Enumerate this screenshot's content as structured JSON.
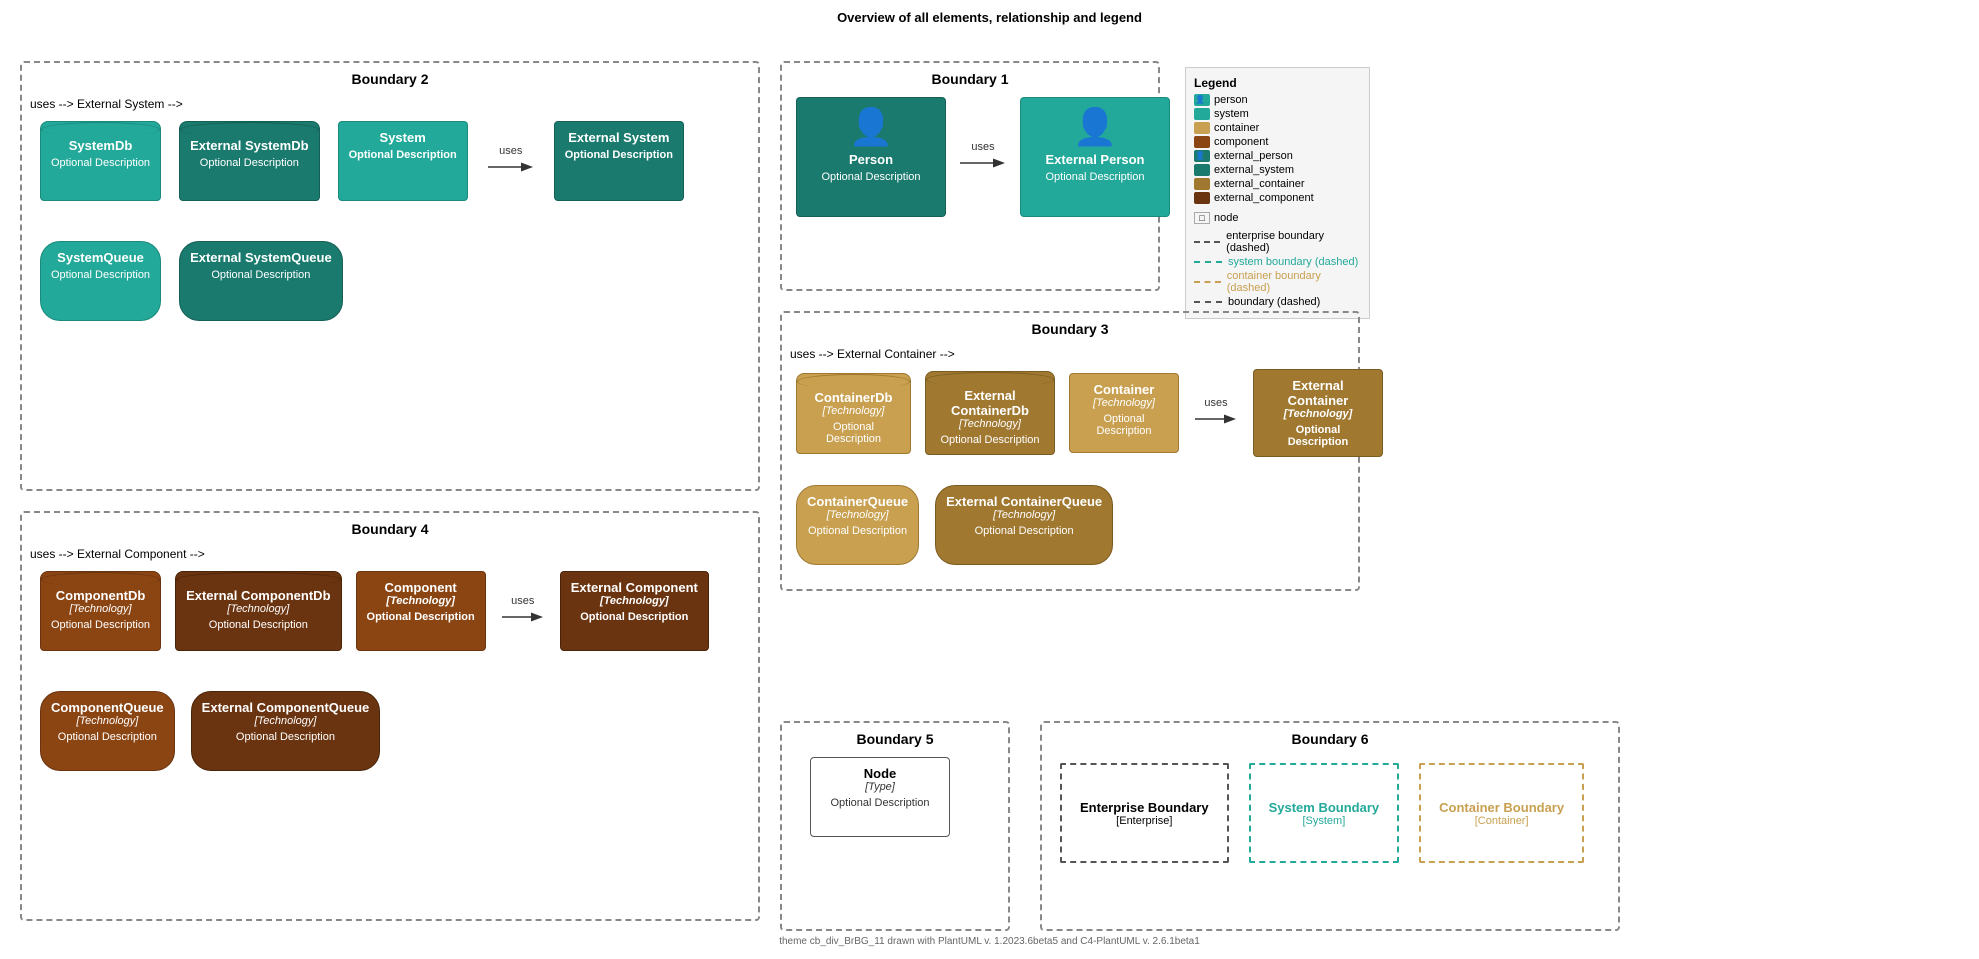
{
  "title": "Overview of all elements, relationship and legend",
  "footer": "theme cb_div_BrBG_11 drawn with PlantUML v. 1.2023.6beta5 and C4-PlantUML v. 2.6.1beta1",
  "uses_label": "uses",
  "optional_desc": "Optional Description",
  "boundaries": {
    "b1": {
      "label": "Boundary 1"
    },
    "b2": {
      "label": "Boundary 2"
    },
    "b3": {
      "label": "Boundary 3"
    },
    "b4": {
      "label": "Boundary 4"
    },
    "b5": {
      "label": "Boundary 5"
    },
    "b6": {
      "label": "Boundary 6"
    }
  },
  "elements": {
    "system_db": {
      "title": "SystemDb",
      "desc": "Optional Description"
    },
    "ext_system_db": {
      "title": "External SystemDb",
      "desc": "Optional Description"
    },
    "system": {
      "title": "System",
      "desc": "Optional Description"
    },
    "ext_system": {
      "title": "External System",
      "desc": "Optional Description"
    },
    "system_queue": {
      "title": "SystemQueue",
      "desc": "Optional Description"
    },
    "ext_system_queue": {
      "title": "External SystemQueue",
      "desc": "Optional Description"
    },
    "person": {
      "title": "Person",
      "desc": "Optional Description"
    },
    "ext_person": {
      "title": "External Person",
      "desc": "Optional Description"
    },
    "container_db": {
      "title": "ContainerDb",
      "tech": "[Technology]",
      "desc": "Optional Description"
    },
    "ext_container_db": {
      "title": "External ContainerDb",
      "tech": "[Technology]",
      "desc": "Optional Description"
    },
    "container": {
      "title": "Container",
      "tech": "[Technology]",
      "desc": "Optional Description"
    },
    "ext_container": {
      "title": "External Container",
      "tech": "[Technology]",
      "desc": "Optional Description"
    },
    "container_queue": {
      "title": "ContainerQueue",
      "tech": "[Technology]",
      "desc": "Optional Description"
    },
    "ext_container_queue": {
      "title": "External ContainerQueue",
      "tech": "[Technology]",
      "desc": "Optional Description"
    },
    "component_db": {
      "title": "ComponentDb",
      "tech": "[Technology]",
      "desc": "Optional Description"
    },
    "ext_component_db": {
      "title": "External ComponentDb",
      "tech": "[Technology]",
      "desc": "Optional Description"
    },
    "component": {
      "title": "Component",
      "tech": "[Technology]",
      "desc": "Optional Description"
    },
    "ext_component": {
      "title": "External Component",
      "tech": "[Technology]",
      "desc": "Optional Description"
    },
    "component_queue": {
      "title": "ComponentQueue",
      "tech": "[Technology]",
      "desc": "Optional Description"
    },
    "ext_component_queue": {
      "title": "External ComponentQueue",
      "tech": "[Technology]",
      "desc": "Optional Description"
    },
    "node": {
      "title": "Node",
      "tech": "[Type]",
      "desc": "Optional Description"
    }
  },
  "legend": {
    "title": "Legend",
    "items": [
      {
        "label": "person",
        "color": "#1a7a6e",
        "type": "swatch"
      },
      {
        "label": "system",
        "color": "#23a99a",
        "type": "swatch"
      },
      {
        "label": "container",
        "color": "#c8a050",
        "type": "swatch"
      },
      {
        "label": "component",
        "color": "#8B4513",
        "type": "swatch"
      },
      {
        "label": "external_person",
        "color": "#23a99a",
        "type": "swatch"
      },
      {
        "label": "external_system",
        "color": "#1a7a6e",
        "type": "swatch"
      },
      {
        "label": "external_container",
        "color": "#a07830",
        "type": "swatch"
      },
      {
        "label": "external_component",
        "color": "#6b3410",
        "type": "swatch"
      },
      {
        "label": "node",
        "color": "#ffffff",
        "type": "icon"
      }
    ],
    "boundaries": [
      {
        "label": "enterprise boundary (dashed)",
        "color": "#555555"
      },
      {
        "label": "system boundary (dashed)",
        "color": "#23a99a"
      },
      {
        "label": "container boundary (dashed)",
        "color": "#c8a050"
      },
      {
        "label": "boundary (dashed)",
        "color": "#555555"
      }
    ]
  },
  "boundary6": {
    "enterprise_label": "Enterprise Boundary",
    "enterprise_sub": "[Enterprise]",
    "system_label": "System Boundary",
    "system_sub": "[System]",
    "container_label": "Container Boundary",
    "container_sub": "[Container]"
  }
}
